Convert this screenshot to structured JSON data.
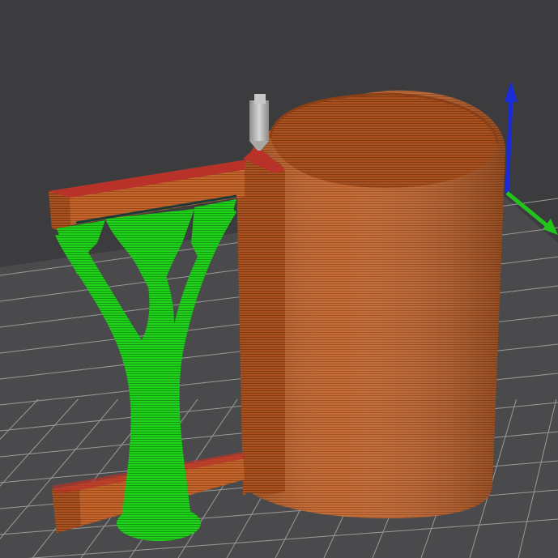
{
  "viewport": {
    "background": "#3c3c3e",
    "bed_color": "#4a4a4c",
    "grid_color": "#9a9a9a"
  },
  "objects": [
    {
      "name": "mug-body",
      "feature": "perimeter",
      "color": "#c4652c"
    },
    {
      "name": "handle",
      "feature": "perimeter",
      "color": "#c4652c"
    },
    {
      "name": "tree-support",
      "feature": "support",
      "color": "#22d11c"
    },
    {
      "name": "overhang",
      "feature": "overhang-perimeter",
      "color": "#b8322a"
    }
  ],
  "toolhead": {
    "icon": "nozzle-icon",
    "color": "#bdbdbd"
  },
  "axes": {
    "z_color": "#1a2bd8",
    "y_color": "#22c41c",
    "x_color": "#cc2222"
  }
}
